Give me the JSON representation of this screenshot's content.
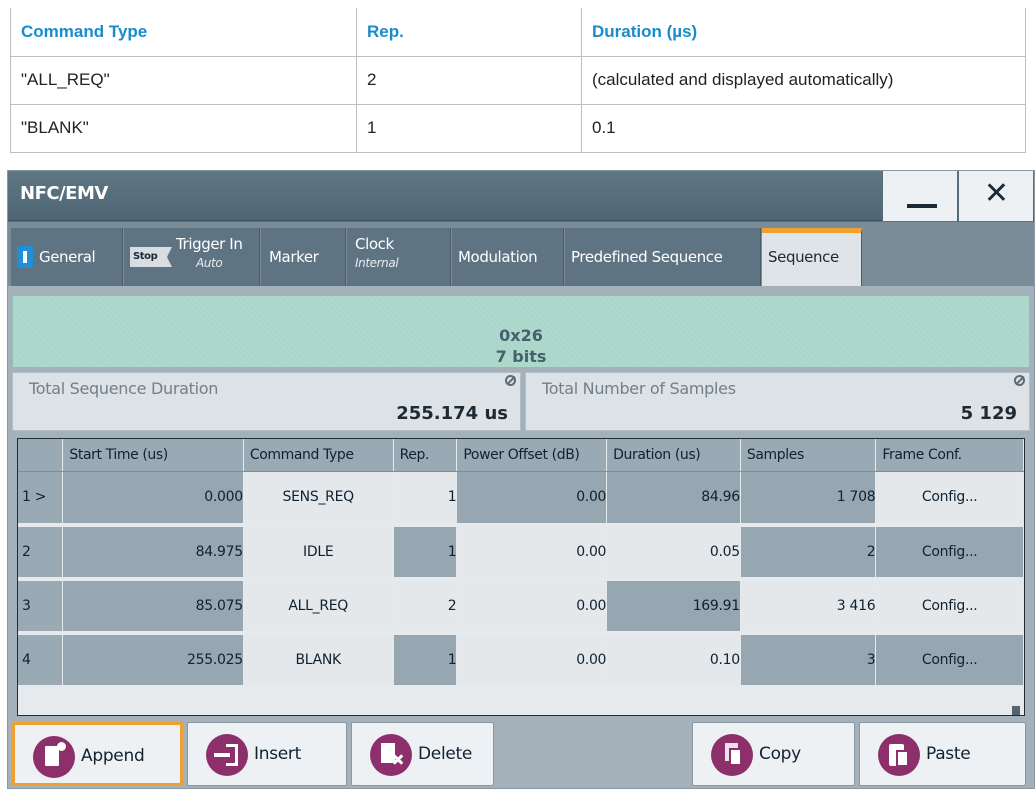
{
  "doc_table": {
    "headers": [
      "Command Type",
      "Rep.",
      "Duration (µs)"
    ],
    "rows": [
      [
        "\"ALL_REQ\"",
        "2",
        "(calculated and displayed automatically)"
      ],
      [
        "\"BLANK\"",
        "1",
        "0.1"
      ]
    ]
  },
  "dialog": {
    "title": "NFC/EMV",
    "close_glyph": "✕",
    "tabs": [
      {
        "label": "General",
        "sub": ""
      },
      {
        "label": "Trigger In",
        "sub": "Auto",
        "badge": "Stop"
      },
      {
        "label": "Marker",
        "sub": ""
      },
      {
        "label": "Clock",
        "sub": "Internal"
      },
      {
        "label": "Modulation",
        "sub": ""
      },
      {
        "label": "Predefined Sequence",
        "sub": ""
      },
      {
        "label": "Sequence",
        "sub": "",
        "active": true
      }
    ],
    "hex_display": {
      "value": "0x26",
      "bits": "7 bits"
    },
    "total_duration": {
      "label": "Total Sequence Duration",
      "value": "255.174 us"
    },
    "total_samples": {
      "label": "Total Number of Samples",
      "value": "5 129"
    },
    "sequence_table": {
      "headers": [
        "",
        "Start Time (us)",
        "Command Type",
        "Rep.",
        "Power Offset (dB)",
        "Duration (us)",
        "Samples",
        "Frame Conf."
      ],
      "rows": [
        {
          "idx": "1 >",
          "start": "0.000",
          "cmd": "SENS_REQ",
          "rep": "1",
          "power": "0.00",
          "duration": "84.96",
          "samples": "1 708",
          "conf": "Config..."
        },
        {
          "idx": "2",
          "start": "84.975",
          "cmd": "IDLE",
          "rep": "1",
          "power": "0.00",
          "duration": "0.05",
          "samples": "2",
          "conf": "Config..."
        },
        {
          "idx": "3",
          "start": "85.075",
          "cmd": "ALL_REQ",
          "rep": "2",
          "power": "0.00",
          "duration": "169.91",
          "samples": "3 416",
          "conf": "Config..."
        },
        {
          "idx": "4",
          "start": "255.025",
          "cmd": "BLANK",
          "rep": "1",
          "power": "0.00",
          "duration": "0.10",
          "samples": "3",
          "conf": "Config..."
        }
      ]
    },
    "buttons": {
      "append": "Append",
      "insert": "Insert",
      "delete": "Delete",
      "copy": "Copy",
      "paste": "Paste"
    },
    "colors": {
      "accent": "#f0a02e",
      "title_bar": "#5f7685",
      "button_icon": "#8d2f6a",
      "hex_display": "#a8d6c9"
    }
  }
}
